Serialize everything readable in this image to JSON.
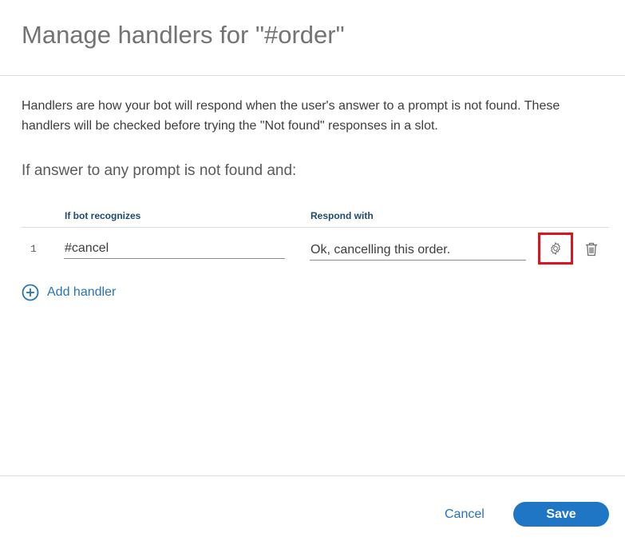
{
  "dialog": {
    "title": "Manage handlers for \"#order\""
  },
  "description": "Handlers are how your bot will respond when the user's answer to a prompt is not found. These handlers will be checked before trying the \"Not found\" responses in a slot.",
  "subheading": "If answer to any prompt is not found and:",
  "table": {
    "columns": {
      "recognizes": "If bot recognizes",
      "respond": "Respond with"
    },
    "rows": [
      {
        "number": "1",
        "intent": "#cancel",
        "response": "Ok, cancelling this order."
      }
    ],
    "row_icons": {
      "settings": "gear-icon",
      "delete": "trash-icon"
    }
  },
  "add_handler": {
    "label": "Add handler",
    "icon": "plus-circle-icon"
  },
  "footer": {
    "cancel_label": "Cancel",
    "save_label": "Save"
  },
  "colors": {
    "accent": "#1e76c5",
    "link": "#2773b8",
    "highlight": "#e0121f"
  }
}
